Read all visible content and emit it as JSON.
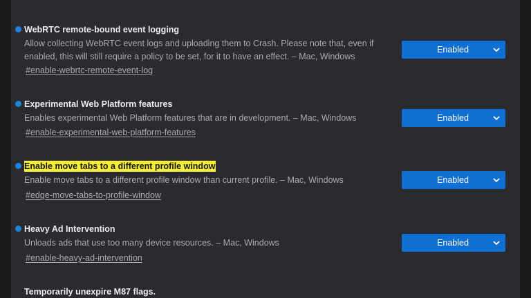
{
  "flags": [
    {
      "title": "WebRTC remote-bound event logging",
      "description": "Allow collecting WebRTC event logs and uploading them to Crash. Please note that, even if enabled, this will still require a policy to be set, for it to have an effect. – Mac, Windows",
      "link": "#enable-webrtc-remote-event-log",
      "selected": "Enabled"
    },
    {
      "title": "Experimental Web Platform features",
      "description": "Enables experimental Web Platform features that are in development. – Mac, Windows",
      "link": "#enable-experimental-web-platform-features",
      "selected": "Enabled"
    },
    {
      "title": "Enable move tabs to a different profile window",
      "description": "Enable move tabs to a different profile window than current profile. – Mac, Windows",
      "link": "#edge-move-tabs-to-profile-window",
      "selected": "Enabled",
      "highlighted": true
    },
    {
      "title": "Heavy Ad Intervention",
      "description": "Unloads ads that use too many device resources. – Mac, Windows",
      "link": "#enable-heavy-ad-intervention",
      "selected": "Enabled"
    }
  ],
  "section_heading": "Temporarily unexpire M87 flags.",
  "colors": {
    "accent": "#0f6fd2",
    "dot": "#1e84e0",
    "highlight": "#f7ef3a",
    "panel": "#2a2b2e"
  }
}
